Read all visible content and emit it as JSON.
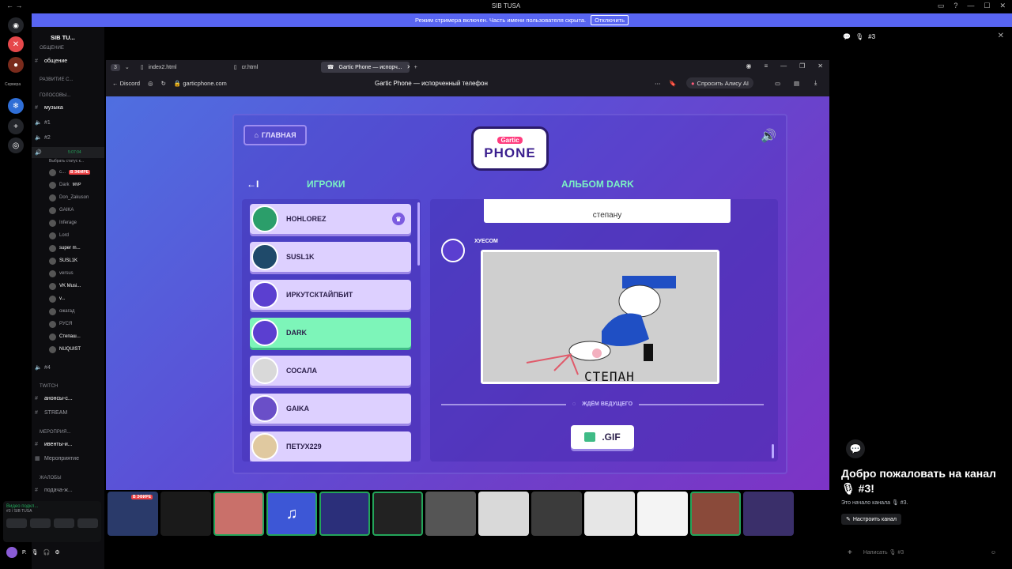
{
  "window": {
    "title": "SIB TUSA"
  },
  "streamer_banner": {
    "text": "Режим стримера включен. Часть имени пользователя скрыта.",
    "button": "Отключить"
  },
  "guilds": {
    "servers_label": "Сервера"
  },
  "sidebar": {
    "server_name": "SIB TU...",
    "categories": [
      {
        "label": "ОБЩЕНИЕ"
      },
      {
        "label": "РАЗВИТИЕ С..."
      },
      {
        "label": "ГОЛОСОВЫ..."
      },
      {
        "label": "TWITCH"
      },
      {
        "label": "МЕРОПРИЯ..."
      },
      {
        "label": "ЖАЛОБЫ"
      }
    ],
    "channels": {
      "obshenie": "общение",
      "muzyka": "музыка",
      "v1": "#1",
      "v2": "#2",
      "v4": "#4",
      "anonsy": "анонсы-с...",
      "stream": "STREAM",
      "iventy": "ивенты-и...",
      "meropriyatie": "Мероприятие",
      "podacha": "подача-ж..."
    },
    "voice_channel": {
      "timer": "5:07:04",
      "status": "Выбрать статус к..."
    },
    "voice_users": [
      "с...",
      "Dark",
      "Don_Zakuson",
      "GAIKA",
      "Inferage",
      "Lord",
      "super m...",
      "SUSL1K",
      "versus",
      "VK Musi...",
      "v...",
      "ожагад",
      "РУСЯ",
      "Степаш...",
      "NUQUIST"
    ],
    "live_badge": "В ЭФИРЕ",
    "mvp_badge": "MVP"
  },
  "voice_connected": {
    "title": "Видео подкл...",
    "sub": "#3 / SIB TUSA"
  },
  "user_panel": {
    "name": "P."
  },
  "browser": {
    "tab_count": "3",
    "tabs": [
      "index2.html",
      "cr.html",
      "Gartic Phone — испорч..."
    ],
    "back_label": "Discord",
    "url": "garticphone.com",
    "page_title": "Gartic Phone — испорченный телефон",
    "alice_label": "Спросить Алису AI"
  },
  "game": {
    "home_label": "ГЛАВНАЯ",
    "logo_small": "Gartic",
    "logo_big": "PHONE",
    "back_icon": "←I",
    "players_heading": "ИГРОКИ",
    "album_heading": "АЛЬБОМ DARK",
    "players": [
      {
        "name": "HOHLOREZ"
      },
      {
        "name": "SUSL1K"
      },
      {
        "name": "ИРКУТСКТАЙПБИТ"
      },
      {
        "name": "DARK"
      },
      {
        "name": "СОСАЛА"
      },
      {
        "name": "GAIKA"
      },
      {
        "name": "ПЕТУХ229"
      }
    ],
    "caption_text": "степану",
    "drawing_author": "ХУЕСОМ",
    "drawing_text": "СТЕПАН",
    "waiting_text": "ЖДЁМ ВЕДУЩЕГО",
    "gif_label": ".GIF"
  },
  "strip": {
    "live_badge": "В ЭФИРЕ"
  },
  "right_panel": {
    "channel": "#3",
    "welcome": "Добро пожаловать на канал 🎙 #3!",
    "start_text": "Это начало канала 🎙 #3.",
    "edit_label": "Настроить канал",
    "composer_placeholder": "Написать 🎙 #3"
  }
}
